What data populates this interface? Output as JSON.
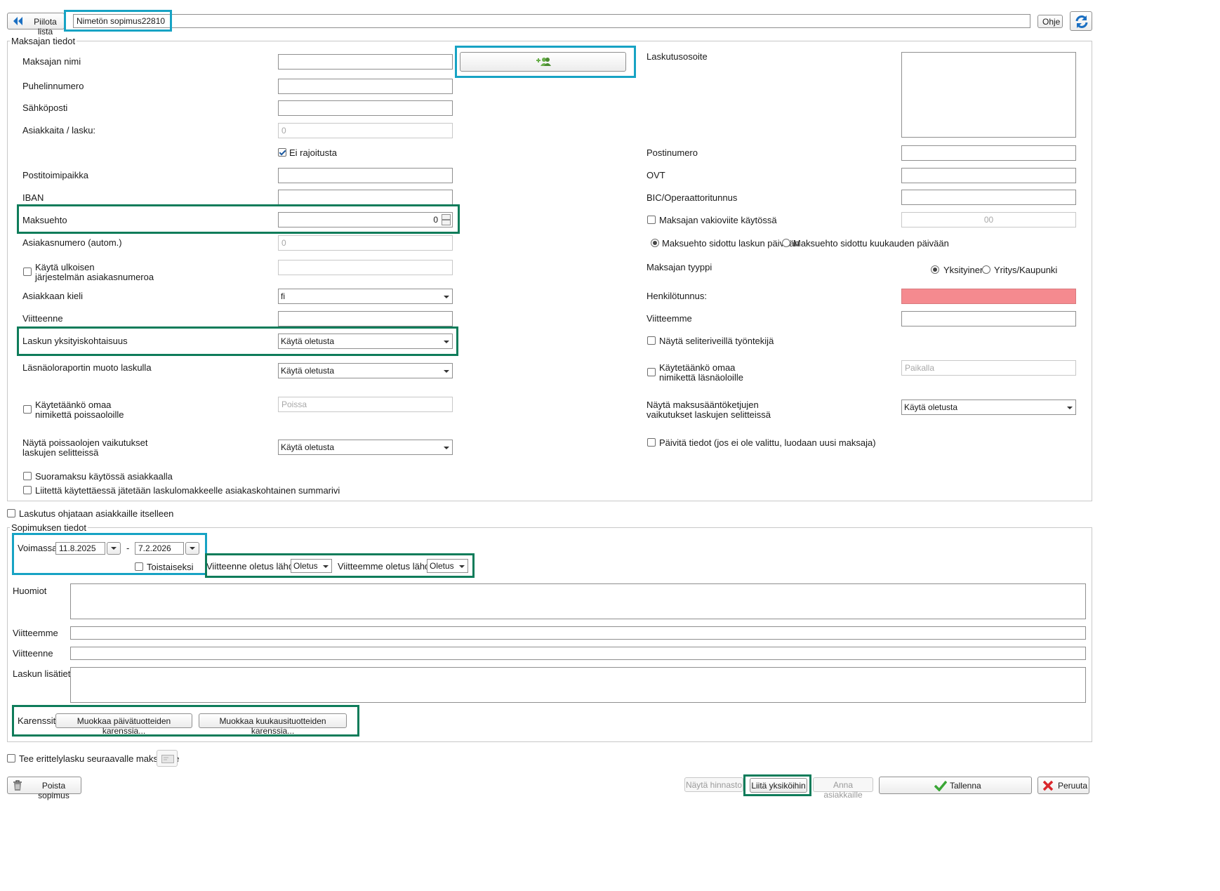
{
  "toolbar": {
    "hide_list": "Piilota lista",
    "contract_name": "Nimetön sopimus22810",
    "help": "Ohje"
  },
  "payer": {
    "section": "Maksajan tiedot",
    "name_label": "Maksajan nimi",
    "phone_label": "Puhelinnumero",
    "email_label": "Sähköposti",
    "customers_per_invoice_label": "Asiakkaita / lasku:",
    "customers_per_invoice_value": "0",
    "no_limit_label": "Ei rajoitusta",
    "city_label": "Postitoimipaikka",
    "iban_label": "IBAN",
    "payment_term_label": "Maksuehto",
    "payment_term_value": "0",
    "customer_number_label": "Asiakasnumero (autom.)",
    "customer_number_value": "0",
    "external_number_label_1": "Käytä ulkoisen",
    "external_number_label_2": "järjestelmän asiakasnumeroa",
    "language_label": "Asiakkaan kieli",
    "language_value": "fi",
    "your_ref_label": "Viitteenne",
    "invoice_privacy_label": "Laskun yksityiskohtaisuus",
    "invoice_privacy_value": "Käytä oletusta",
    "attendance_format_label": "Läsnäoloraportin muoto laskulla",
    "attendance_format_value": "Käytä oletusta",
    "own_absence_title_1": "Käytetäänkö omaa",
    "own_absence_title_2": "nimikettä poissaoloille",
    "absence_placeholder": "Poissa",
    "absence_effects_1": "Näytä poissaolojen vaikutukset",
    "absence_effects_2": "laskujen selitteissä",
    "absence_effects_value": "Käytä oletusta",
    "direct_payment_label": "Suoramaksu käytössä asiakkaalla",
    "attachment_summary_label": "Liitettä käytettäessä jätetään laskulomakkeelle asiakaskohtainen summarivi",
    "billing_address_label": "Laskutusosoite",
    "postal_code_label": "Postinumero",
    "ovt_label": "OVT",
    "bic_label": "BIC/Operaattoritunnus",
    "default_ref_label": "Maksajan vakioviite käytössä",
    "default_ref_value": "00",
    "term_invoice_date": "Maksuehto sidottu laskun päivään",
    "term_month_day": "Maksuehto sidottu kuukauden päivään",
    "payer_type_label": "Maksajan tyyppi",
    "type_private": "Yksityinen",
    "type_company": "Yritys/Kaupunki",
    "ssn_label": "Henkilötunnus:",
    "our_ref_label": "Viitteemme",
    "show_employee_label": "Näytä seliteriveillä työntekijä",
    "own_presence_title_1": "Käytetäänkö omaa",
    "own_presence_title_2": "nimikettä läsnäoloille",
    "presence_placeholder": "Paikalla",
    "fee_rule_effects_1": "Näytä maksusääntöketjujen",
    "fee_rule_effects_2": "vaikutukset laskujen selitteissä",
    "fee_rule_effects_value": "Käytä oletusta",
    "update_info_label": "Päivitä tiedot (jos ei ole valittu, luodaan uusi maksaja)"
  },
  "self_billing_label": "Laskutus ohjataan asiakkaille itselleen",
  "contract": {
    "section": "Sopimuksen tiedot",
    "valid_label": "Voimassa:",
    "start_date": "11.8.2025",
    "dash": "-",
    "end_date": "7.2.2026",
    "until_further_label": "Toistaiseksi",
    "your_ref_source_label": "Viitteenne oletus lähde",
    "your_ref_source_value": "Oletus",
    "our_ref_source_label": "Viitteemme oletus lähde",
    "our_ref_source_value": "Oletus",
    "notes_label": "Huomiot",
    "our_ref_label": "Viitteemme",
    "your_ref_label": "Viitteenne",
    "invoice_extra_label": "Laskun lisätieto",
    "waiting_label": "Karenssit:",
    "edit_daily_waiting": "Muokkaa päivätuotteiden karenssia...",
    "edit_monthly_waiting": "Muokkaa kuukausituotteiden karenssia..."
  },
  "itemized_invoice_label": "Tee erittelylasku seuraavalle maksajalle",
  "footer": {
    "delete": "Poista sopimus",
    "show_prices": "Näytä hinnasto",
    "attach_units": "Liitä yksiköihin",
    "give_customers": "Anna asiakkaille",
    "save": "Tallenna",
    "cancel": "Peruuta"
  },
  "colors": {
    "highlight_blue": "#17a3c4",
    "highlight_green": "#0e7c5a",
    "ssn_field": "#f58a8f",
    "toolbar_icon": "#1a6fc2"
  },
  "icons": [
    "double-chevron-left-icon",
    "refresh-icon",
    "add-user-icon",
    "trash-icon",
    "check-icon",
    "cross-icon",
    "card-icon"
  ]
}
